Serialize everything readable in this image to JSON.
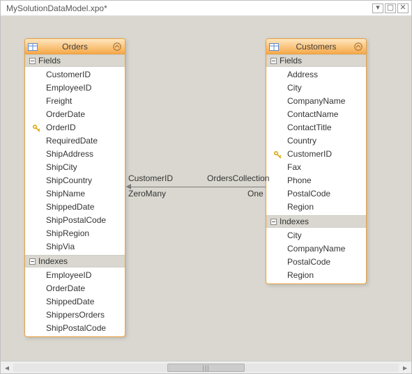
{
  "window": {
    "title": "MySolutionDataModel.xpo*"
  },
  "entities": {
    "orders": {
      "title": "Orders",
      "fields_label": "Fields",
      "indexes_label": "Indexes",
      "fields": [
        "CustomerID",
        "EmployeeID",
        "Freight",
        "OrderDate",
        "OrderID",
        "RequiredDate",
        "ShipAddress",
        "ShipCity",
        "ShipCountry",
        "ShipName",
        "ShippedDate",
        "ShipPostalCode",
        "ShipRegion",
        "ShipVia"
      ],
      "key_field": "OrderID",
      "indexes": [
        "EmployeeID",
        "OrderDate",
        "ShippedDate",
        "ShippersOrders",
        "ShipPostalCode"
      ]
    },
    "customers": {
      "title": "Customers",
      "fields_label": "Fields",
      "indexes_label": "Indexes",
      "fields": [
        "Address",
        "City",
        "CompanyName",
        "ContactName",
        "ContactTitle",
        "Country",
        "CustomerID",
        "Fax",
        "Phone",
        "PostalCode",
        "Region"
      ],
      "key_field": "CustomerID",
      "indexes": [
        "City",
        "CompanyName",
        "PostalCode",
        "Region"
      ]
    }
  },
  "relationship": {
    "left_end": "CustomerID",
    "right_end": "OrdersCollection",
    "left_card": "ZeroMany",
    "right_card": "One"
  }
}
